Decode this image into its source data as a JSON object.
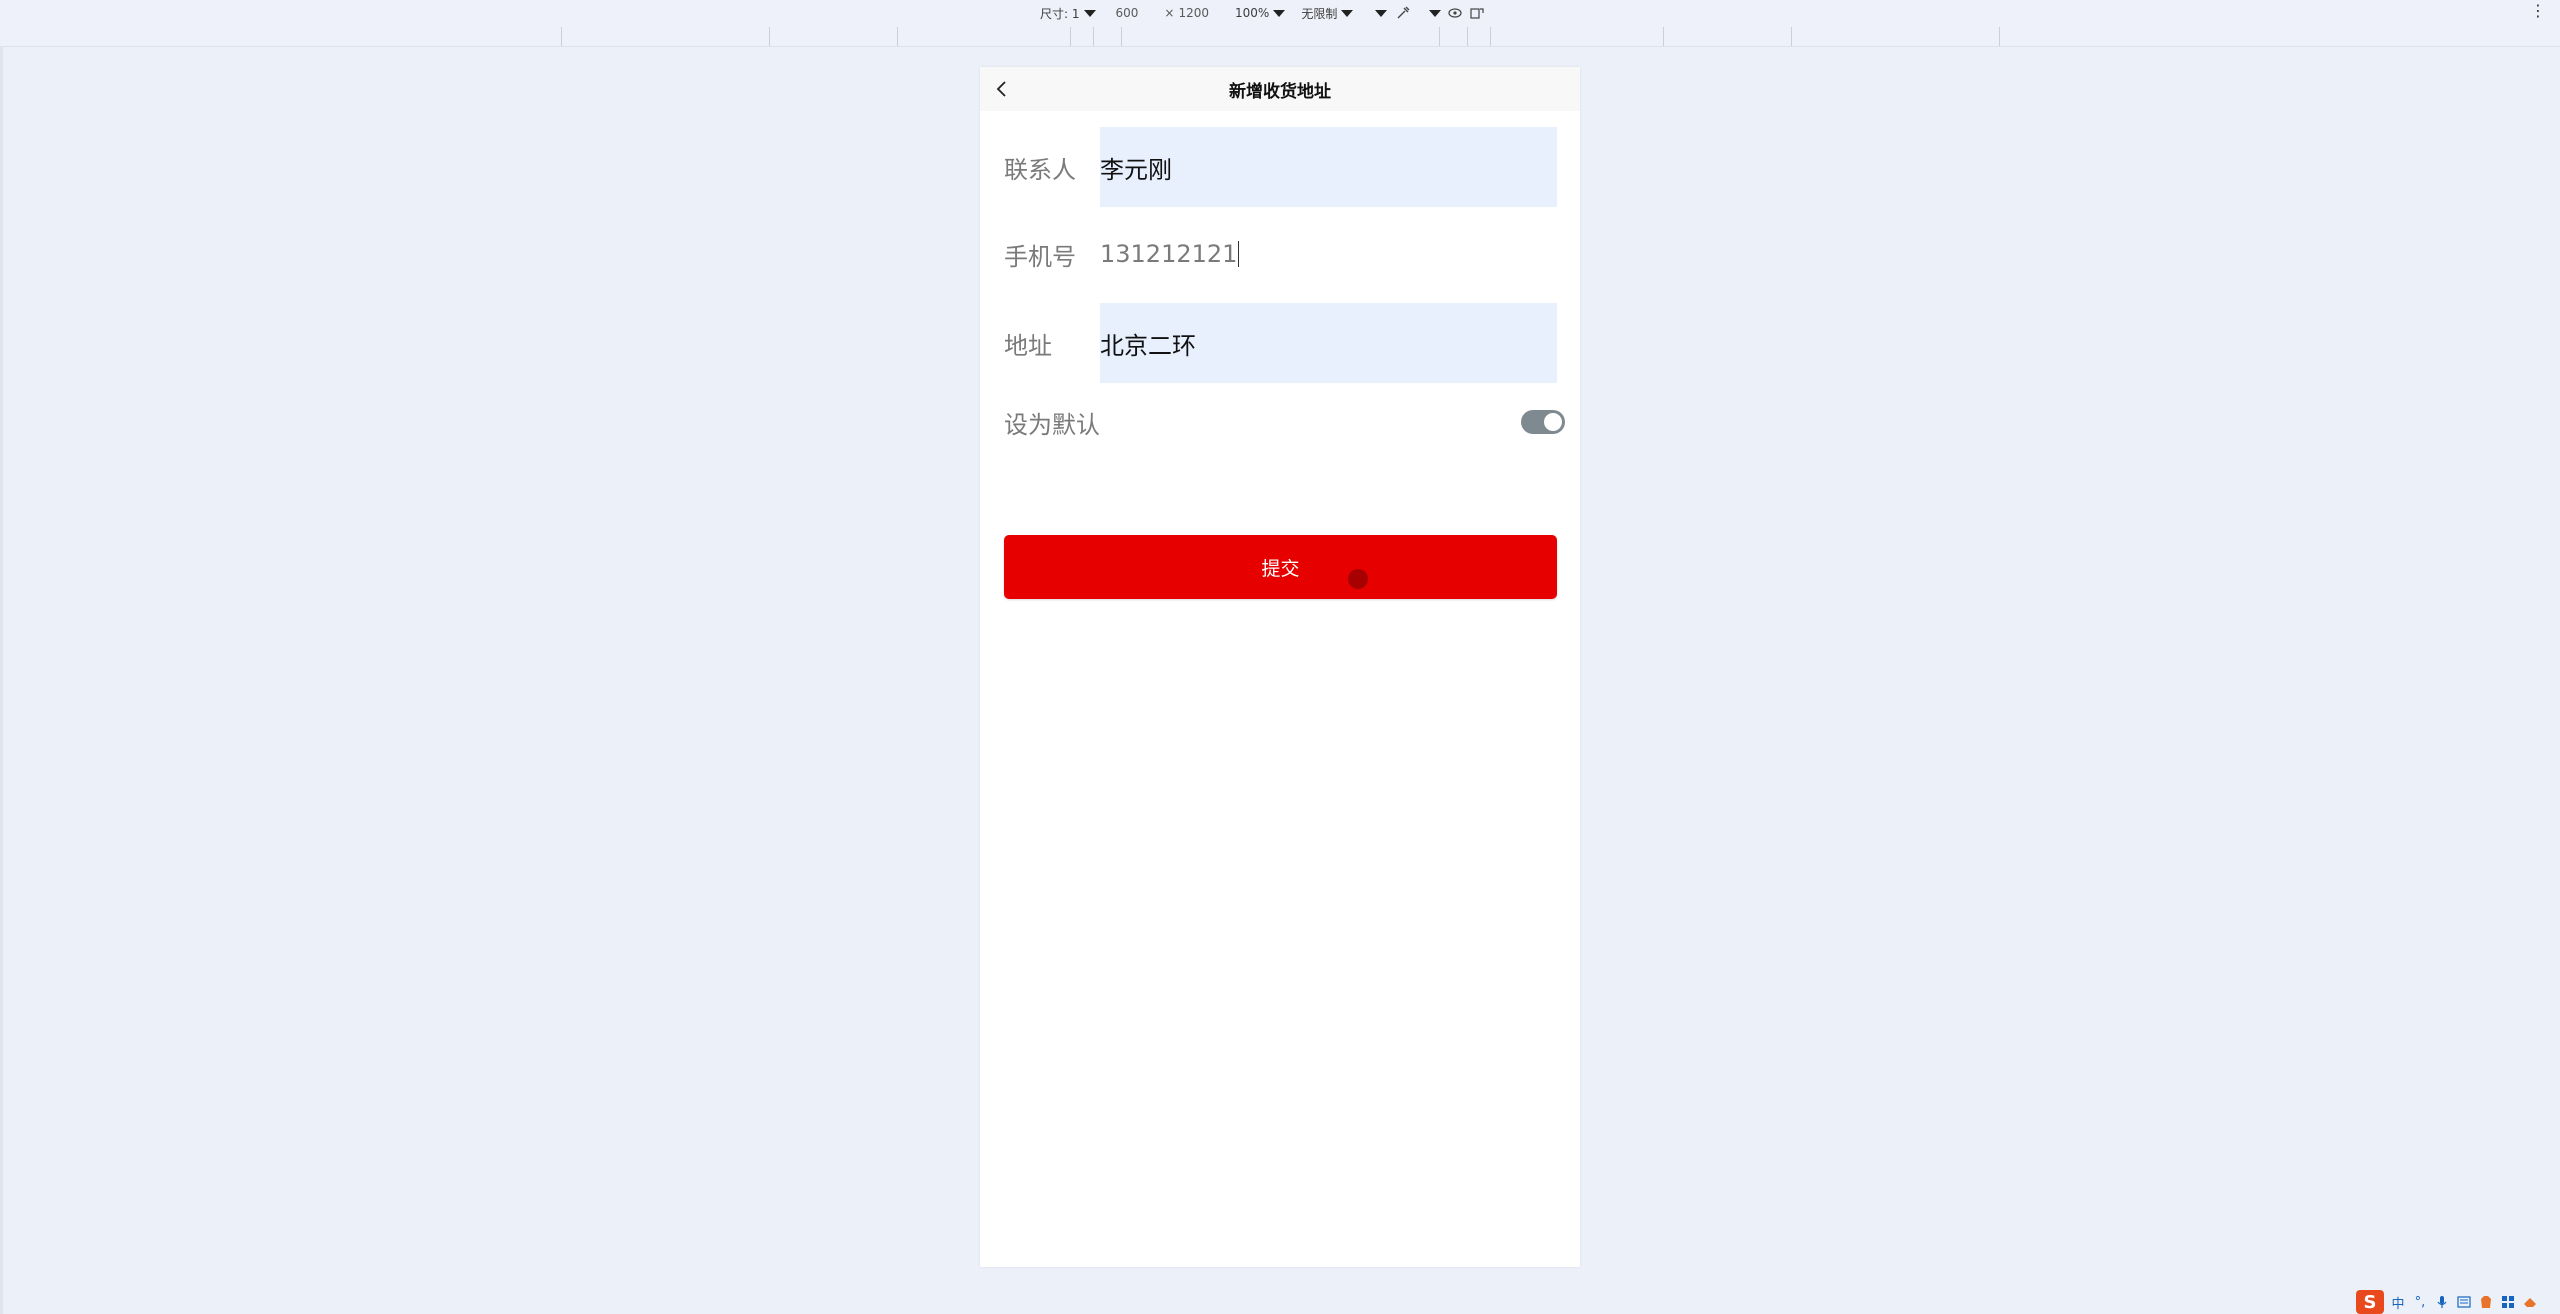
{
  "devtools": {
    "dimensions_label": "尺寸: 1",
    "width": "600",
    "times": "×",
    "height": "1200",
    "zoom": "100%",
    "throttle": "无限制",
    "menu_icon": "kebab-menu-icon"
  },
  "page": {
    "title": "新增收货地址",
    "back_icon": "chevron-left-icon"
  },
  "form": {
    "contact": {
      "label": "联系人",
      "value": "李元刚"
    },
    "phone": {
      "label": "手机号",
      "value": "131212121"
    },
    "address": {
      "label": "地址",
      "value": "北京二环"
    },
    "default": {
      "label": "设为默认",
      "on": true
    }
  },
  "submit_label": "提交",
  "ime": {
    "logo": "S",
    "mode": "中",
    "punct": "°,",
    "icons": [
      "microphone-icon",
      "keyboard-icon",
      "skin-icon",
      "toolbox-icon",
      "settings-icon"
    ]
  },
  "colors": {
    "primary": "#e60000",
    "input_fill": "#e9f0fd",
    "switch_on": "#7f8a90",
    "background": "#ecf0f9"
  }
}
